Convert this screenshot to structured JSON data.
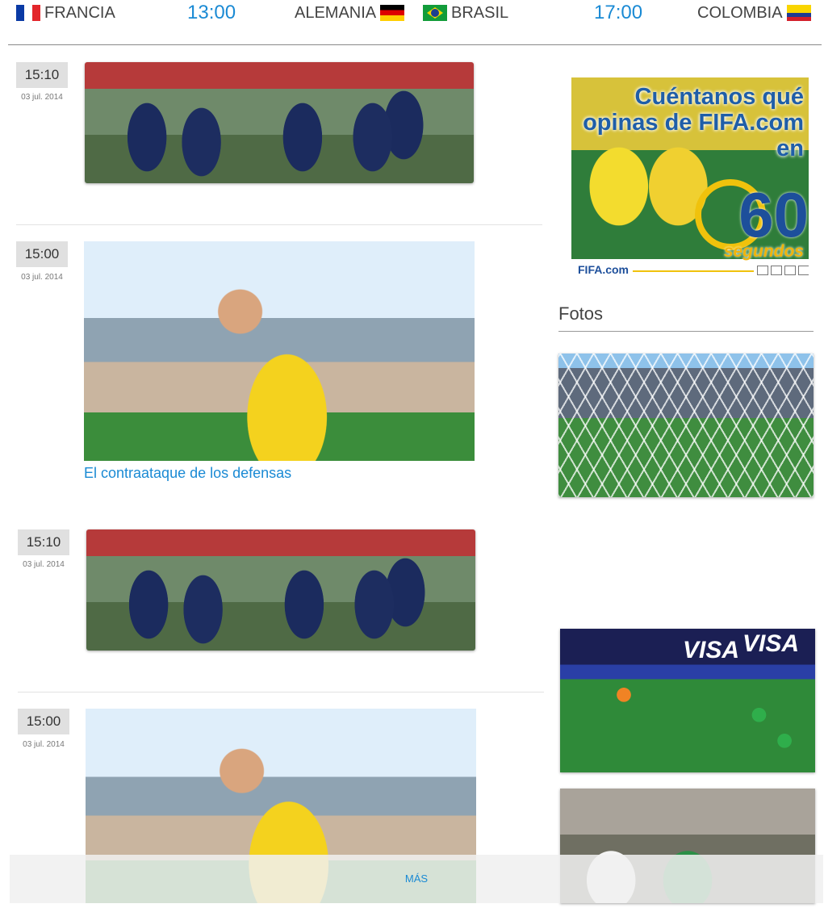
{
  "matches": [
    {
      "home": "FRANCIA",
      "time": "13:00",
      "away": "ALEMANIA"
    },
    {
      "home": "BRASIL",
      "time": "17:00",
      "away": "COLOMBIA"
    }
  ],
  "timeline": [
    {
      "time": "15:10",
      "date": "03 jul. 2014"
    },
    {
      "time": "15:00",
      "date": "03 jul. 2014",
      "title": "El contraataque de los defensas"
    },
    {
      "time": "15:10",
      "date": "03 jul. 2014"
    },
    {
      "time": "15:00",
      "date": "03 jul. 2014"
    }
  ],
  "ad": {
    "title_line1": "Cuéntanos qué",
    "title_line2": "opinas de FIFA.com",
    "title_line3": "en",
    "number": "60",
    "unit": "segundos",
    "logo": "FIFA.com"
  },
  "sidebar": {
    "section_title": "Fotos",
    "banner_text": "VISA"
  },
  "more_label": "MÁS",
  "colors": {
    "link": "#1a8ad4",
    "badge": "#e0e0e0"
  },
  "icons": [
    "flag-france-icon",
    "flag-germany-icon",
    "flag-brazil-icon",
    "flag-colombia-icon"
  ]
}
